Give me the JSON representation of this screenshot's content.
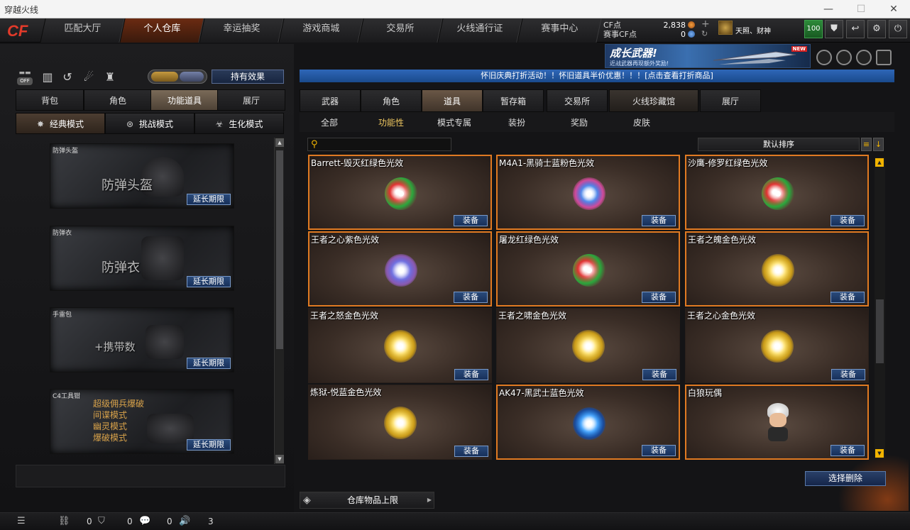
{
  "window": {
    "title": "穿越火线",
    "minimize": "—",
    "maximize": "☐",
    "close": "✕"
  },
  "topnav": {
    "logo": "CF",
    "tabs": [
      "匹配大厅",
      "个人仓库",
      "幸运抽奖",
      "游戏商城",
      "交易所",
      "火线通行证",
      "赛事中心"
    ],
    "active_tab": "个人仓库",
    "cf_label": "CF点",
    "match_cf_label": "赛事CF点",
    "cf_value": "2,838",
    "match_cf_value": "0",
    "username": "天照、财神",
    "level": "100"
  },
  "banner": {
    "title": "成长武器!",
    "subtitle": "近战武器再现额外奖励!",
    "badge": "NEW"
  },
  "left": {
    "sound_badge": "OFF",
    "effect_button": "持有效果",
    "tabs": [
      "背包",
      "角色",
      "功能道具",
      "展厅"
    ],
    "active_tab": "功能道具",
    "mode_tabs": [
      "经典模式",
      "挑战模式",
      "生化模式"
    ],
    "slots": [
      {
        "name": "防弹头盔",
        "big": "防弹头盔",
        "action": "延长期限"
      },
      {
        "name": "防弹衣",
        "big": "防弹衣",
        "action": "延长期限"
      },
      {
        "name": "手雷包",
        "big": "+携带数",
        "action": "延长期限"
      },
      {
        "name": "C4工具钳",
        "lines": [
          "超级佣兵爆破",
          "间谍模式",
          "幽灵模式",
          "爆破模式"
        ],
        "action": "延长期限"
      }
    ]
  },
  "notice": "怀旧庆典打折活动！！怀旧道具半价优惠！！！[点击查看打折商品]",
  "right": {
    "tabs": [
      "武器",
      "角色",
      "道具",
      "暂存箱",
      "交易所",
      "火线珍藏馆",
      "展厅"
    ],
    "active_tab": "道具",
    "subtabs": [
      "全部",
      "功能性",
      "模式专属",
      "装扮",
      "奖励",
      "皮肤"
    ],
    "active_subtab": "功能性",
    "search_placeholder": "",
    "sort_label": "默认排序",
    "items": [
      {
        "name": "Barrett-毁灭红绿色光效",
        "button": "装备"
      },
      {
        "name": "M4A1-黑骑士蓝粉色光效",
        "button": "装备"
      },
      {
        "name": "沙鹰-修罗红绿色光效",
        "button": "装备"
      },
      {
        "name": "王者之心紫色光效",
        "button": "装备"
      },
      {
        "name": "屠龙红绿色光效",
        "button": "装备"
      },
      {
        "name": "王者之魄金色光效",
        "button": "装备"
      },
      {
        "name": "王者之怒金色光效",
        "button": "装备"
      },
      {
        "name": "王者之啸金色光效",
        "button": "装备"
      },
      {
        "name": "王者之心金色光效",
        "button": "装备"
      },
      {
        "name": "炼狱-悦蓝金色光效",
        "button": "装备"
      },
      {
        "name": "AK47-黑武士蓝色光效",
        "button": "装备"
      },
      {
        "name": "白狼玩偶",
        "button": "装备"
      }
    ],
    "delete_button": "选择删除",
    "storage_limit": "仓库物品上限"
  },
  "statusbar": {
    "count1": "0",
    "count2": "0",
    "count3": "0",
    "count4": "3"
  },
  "colors": {
    "accent_orange": "#e07a22",
    "accent_blue": "#2e67b8",
    "gold": "#f0c860"
  }
}
